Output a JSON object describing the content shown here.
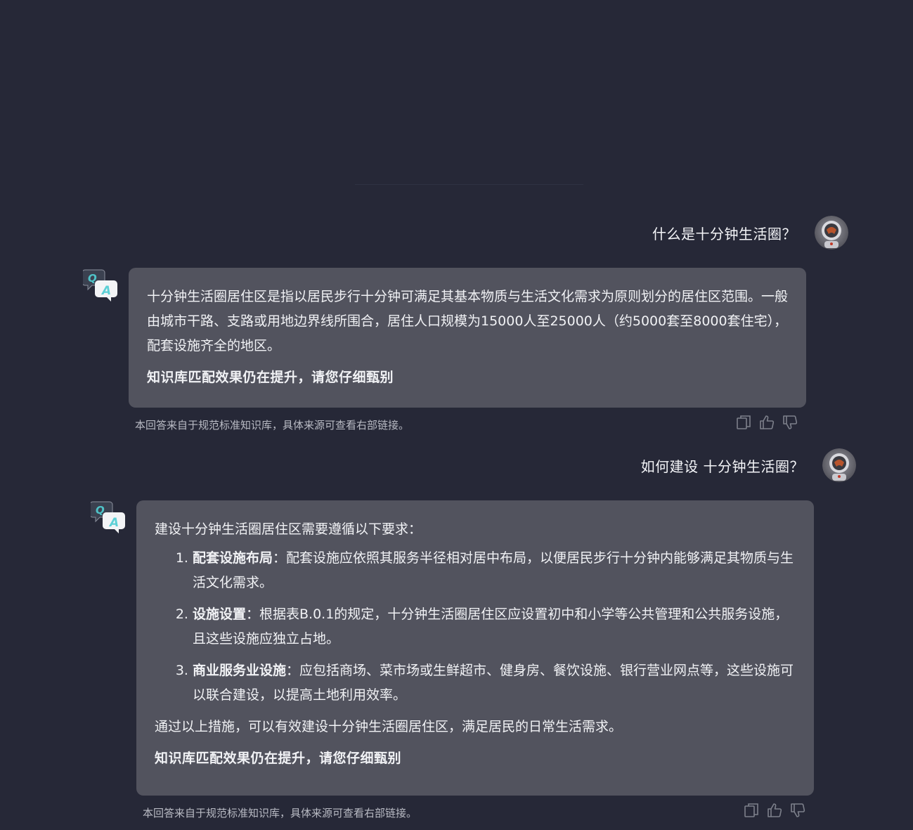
{
  "conversation": [
    {
      "question": "什么是十分钟生活圈？",
      "answer": {
        "paragraph": "十分钟生活圈居住区是指以居民步行十分钟可满足其基本物质与生活文化需求为原则划分的居住区范围。一般由城市干路、支路或用地边界线所围合，居住人口规模为15000人至25000人（约5000套至8000套住宅），配套设施齐全的地区。",
        "note": "知识库匹配效果仍在提升，请您仔细甄别"
      },
      "source": "本回答来自于规范标准知识库，具体来源可查看右部链接。"
    },
    {
      "question": "如何建设 十分钟生活圈？",
      "answer": {
        "intro": "建设十分钟生活圈居住区需要遵循以下要求：",
        "items": [
          {
            "title": "配套设施布局",
            "text": "：配套设施应依照其服务半径相对居中布局，以便居民步行十分钟内能够满足其物质与生活文化需求。"
          },
          {
            "title": "设施设置",
            "text": "：根据表B.0.1的规定，十分钟生活圈居住区应设置初中和小学等公共管理和公共服务设施，且这些设施应独立占地。"
          },
          {
            "title": "商业服务业设施",
            "text": "：应包括商场、菜市场或生鲜超市、健身房、餐饮设施、银行营业网点等，这些设施可以联合建设，以提高土地利用效率。"
          }
        ],
        "summary": "通过以上措施，可以有效建设十分钟生活圈居住区，满足居民的日常生活需求。",
        "note": "知识库匹配效果仍在提升，请您仔细甄别"
      },
      "source": "本回答来自于规范标准知识库，具体来源可查看右部链接。"
    }
  ],
  "icons": {
    "qa": "qa-icon",
    "copy": "copy-icon",
    "like": "thumbs-up-icon",
    "dislike": "thumbs-down-icon",
    "avatar": "astronaut-avatar"
  },
  "colors": {
    "background": "#262837",
    "bubble": "#52535e",
    "qa_q": "#4fc3c8",
    "qa_a": "#5cd0d6"
  }
}
